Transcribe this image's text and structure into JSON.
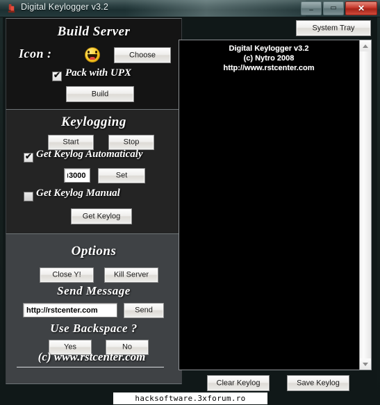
{
  "window": {
    "title": "Digital Keylogger v3.2",
    "icon": "app-icon",
    "minimize_label": "–",
    "maximize_label": "▭",
    "close_label": "✕"
  },
  "build": {
    "section_title": "Build Server",
    "system_tray_label": "System Tray",
    "icon_label": "Icon :",
    "icon_preview": "smiley-icon",
    "choose_label": "Choose",
    "pack_upx_label": "Pack with UPX",
    "pack_upx_checked": "✔",
    "build_label": "Build"
  },
  "keylogging": {
    "section_title": "Keylogging",
    "start_label": "Start",
    "stop_label": "Stop",
    "auto_label": "Get Keylog Automaticaly",
    "auto_checked": "✔",
    "interval_value": "3000",
    "set_label": "Set",
    "manual_label": "Get Keylog Manual",
    "get_keylog_label": "Get Keylog"
  },
  "options": {
    "section_title": "Options",
    "close_ym_label": "Close Y!",
    "kill_server_label": "Kill Server",
    "send_message_title": "Send Message",
    "message_value": "http://rstcenter.com",
    "send_label": "Send",
    "backspace_title": "Use Backspace ?",
    "yes_label": "Yes",
    "no_label": "No"
  },
  "footer": {
    "copyright": "(c) www.rstcenter.com",
    "watermark": "hacksoftware.3xforum.ro"
  },
  "log": {
    "line1": "Digital Keylogger v3.2",
    "line2": "(c) Nytro 2008",
    "line3": "http://www.rstcenter.com"
  },
  "bottom_bar": {
    "clear_keylog_label": "Clear Keylog",
    "save_keylog_label": "Save Keylog"
  },
  "colors": {
    "window_bg": "#101818",
    "panel_dark": "#141414",
    "panel_mid": "#242424",
    "panel_light": "#3f4245",
    "log_bg": "#000000",
    "accent_close": "#c7392c"
  }
}
